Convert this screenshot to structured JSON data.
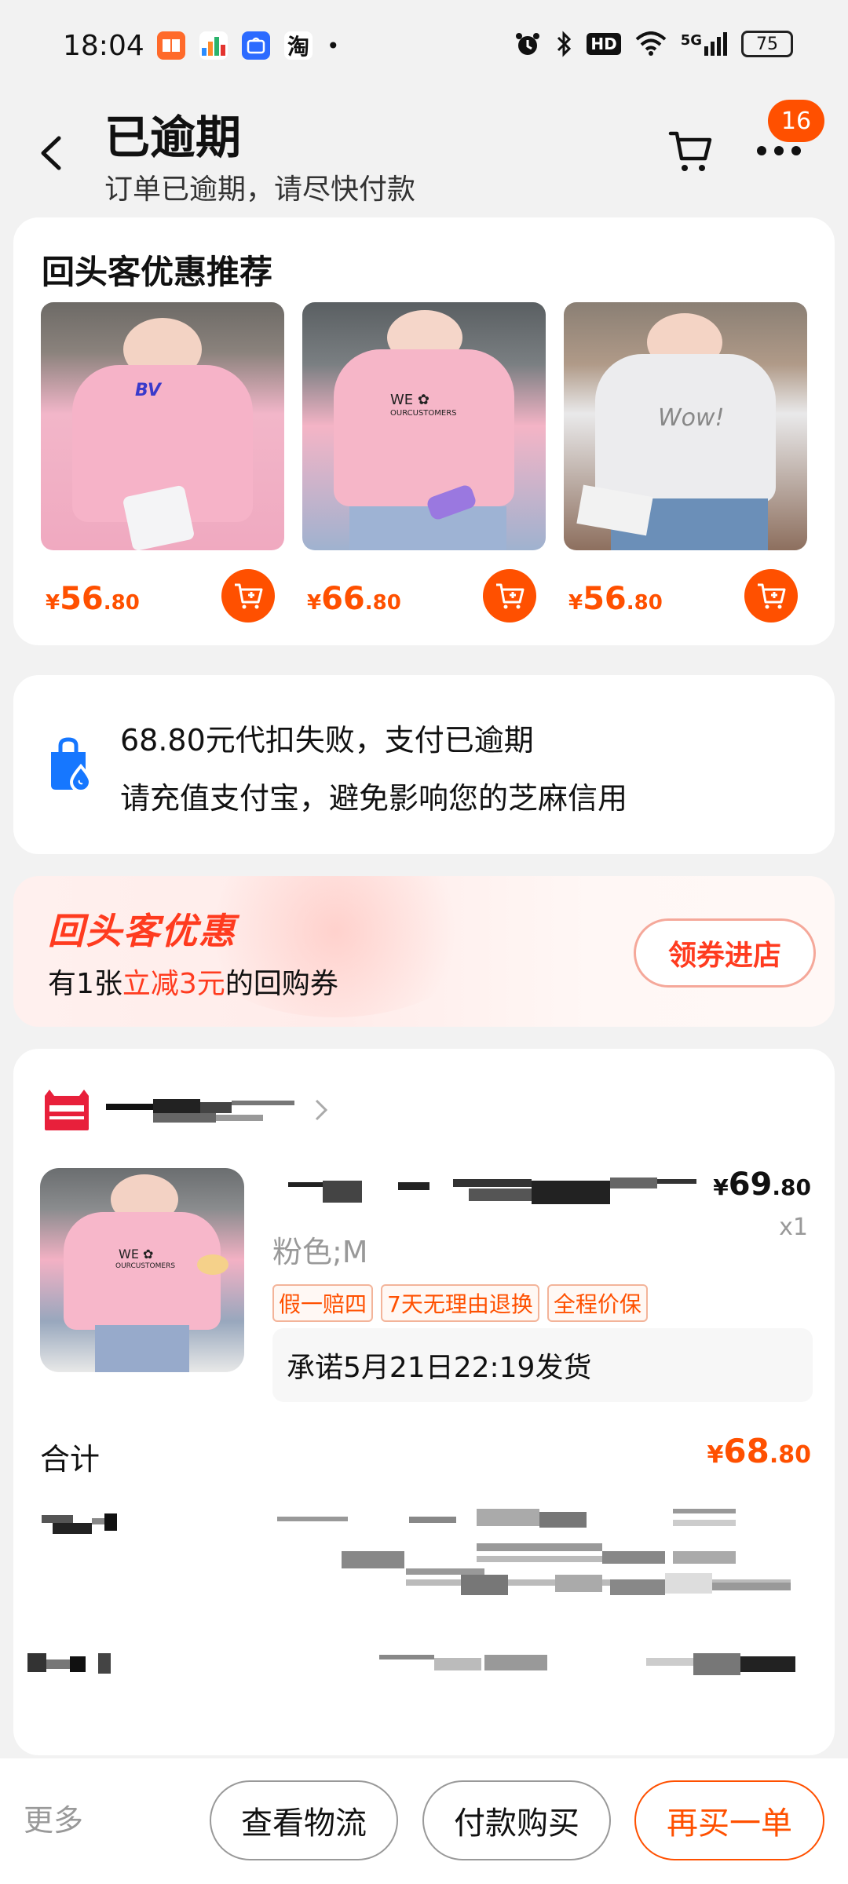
{
  "status_bar": {
    "time": "18:04",
    "apps": [
      {
        "name": "books-app-icon",
        "color": "#ff6a2a",
        "glyph": "📖"
      },
      {
        "name": "chart-app-icon",
        "color": "#ffffff",
        "glyph": ""
      },
      {
        "name": "store-app-icon",
        "color": "#2c6bff",
        "glyph": ""
      },
      {
        "name": "taobao-app-icon",
        "color": "#ffffff",
        "glyph": "淘"
      }
    ],
    "dot": "•",
    "network": "5G",
    "battery": "75"
  },
  "header": {
    "title": "已逾期",
    "subtitle": "订单已逾期，请尽快付款",
    "badge_count": "16"
  },
  "recommend": {
    "title": "回头客优惠推荐",
    "items": [
      {
        "cur": "¥",
        "int": "56",
        "dec": ".80",
        "img_bg": "#f2b6c9"
      },
      {
        "cur": "¥",
        "int": "66",
        "dec": ".80",
        "img_bg": "#f4b4c6"
      },
      {
        "cur": "¥",
        "int": "56",
        "dec": ".80",
        "img_bg": "#e9e9ea"
      }
    ]
  },
  "notice": {
    "line1": "68.80元代扣失败，支付已逾期",
    "line2": "请充值支付宝，避免影响您的芝麻信用"
  },
  "promo": {
    "title": "回头客优惠",
    "desc_prefix": "有1张",
    "desc_highlight": "立减3元",
    "desc_suffix": "的回购券",
    "button": "领券进店"
  },
  "order": {
    "product": {
      "price_cur": "¥",
      "price_int": "69",
      "price_dec": ".80",
      "qty": "x1",
      "sku": "粉色;M",
      "tags": [
        "假一赔四",
        "7天无理由退换",
        "全程价保"
      ],
      "promise": "承诺5月21日22:19发货"
    },
    "total_label": "合计",
    "total_cur": "¥",
    "total_int": "68",
    "total_dec": ".80"
  },
  "bottom": {
    "more": "更多",
    "logistics": "查看物流",
    "pay": "付款购买",
    "rebuy": "再买一单"
  },
  "colors": {
    "accent": "#ff5000",
    "promo_red": "#ff3b1f",
    "alipay_blue": "#1677ff"
  }
}
